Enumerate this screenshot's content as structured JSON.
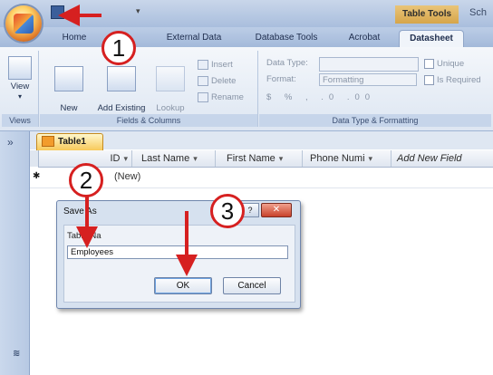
{
  "title_bar": {
    "context_tools": "Table Tools",
    "title_clip": "Sch"
  },
  "tabs": {
    "home": "Home",
    "external_data": "External Data",
    "database_tools": "Database Tools",
    "acrobat": "Acrobat",
    "datasheet": "Datasheet"
  },
  "ribbon": {
    "views": {
      "view": "View",
      "group": "Views"
    },
    "fields_columns": {
      "new_field": "New\nField",
      "add_existing_fields": "Add Existing\nFields",
      "lookup_column": "Lookup\nColumn",
      "insert": "Insert",
      "delete": "Delete",
      "rename": "Rename",
      "group": "Fields & Columns"
    },
    "data_type_formatting": {
      "data_type_label": "Data Type:",
      "format_label": "Format:",
      "format_value": "Formatting",
      "unique": "Unique",
      "is_required": "Is Required",
      "group": "Data Type & Formatting"
    }
  },
  "document": {
    "tab_name": "Table1",
    "columns": [
      "ID",
      "Last Name",
      "First Name",
      "Phone Numi",
      "Add New Field"
    ],
    "new_row_value": "(New)"
  },
  "dialog": {
    "title": "Save As",
    "help": "?",
    "close": "✕",
    "field_label": "Table Na",
    "field_value": "Employees",
    "ok": "OK",
    "cancel": "Cancel"
  },
  "annotations": {
    "steps": [
      "1",
      "2",
      "3"
    ],
    "color": "#d62020"
  }
}
